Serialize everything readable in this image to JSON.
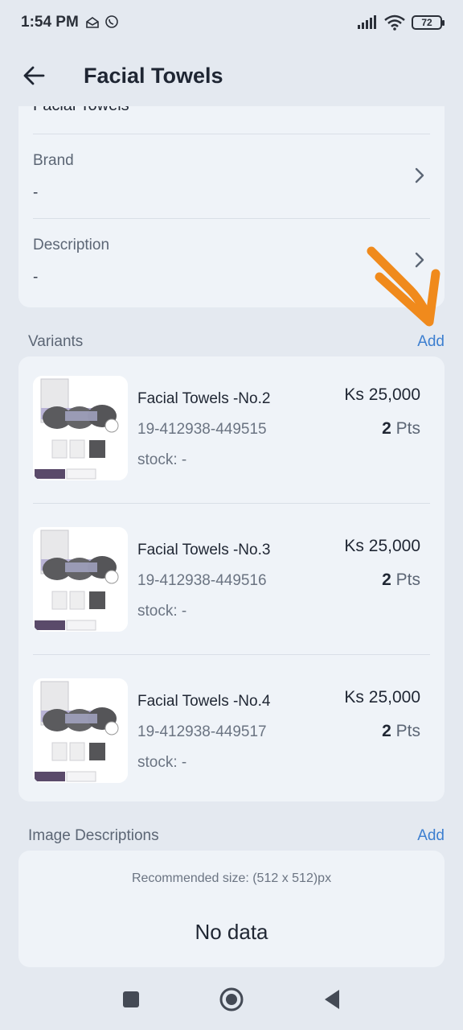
{
  "status_bar": {
    "time": "1:54 PM",
    "battery": "72"
  },
  "header": {
    "title": "Facial Towels"
  },
  "info_card": {
    "clipped_name": "Facial Towels",
    "rows": [
      {
        "label": "Brand",
        "value": "-"
      },
      {
        "label": "Description",
        "value": "-"
      }
    ]
  },
  "variants": {
    "title": "Variants",
    "add_label": "Add",
    "items": [
      {
        "name": "Facial Towels -No.2",
        "sku": "19-412938-449515",
        "stock": "stock: -",
        "price": "Ks 25,000",
        "pts_value": "2",
        "pts_unit": "Pts"
      },
      {
        "name": "Facial Towels -No.3",
        "sku": "19-412938-449516",
        "stock": "stock: -",
        "price": "Ks 25,000",
        "pts_value": "2",
        "pts_unit": "Pts"
      },
      {
        "name": "Facial Towels -No.4",
        "sku": "19-412938-449517",
        "stock": "stock: -",
        "price": "Ks 25,000",
        "pts_value": "2",
        "pts_unit": "Pts"
      }
    ]
  },
  "image_descriptions": {
    "title": "Image Descriptions",
    "add_label": "Add",
    "recommended": "Recommended size: (512 x 512)px",
    "empty": "No data"
  },
  "colors": {
    "accent": "#3d7fd0",
    "annotation": "#f08a1c",
    "background": "#e4e9f0",
    "card": "#eff3f8"
  },
  "icons": [
    "back-arrow-icon",
    "chevron-right-icon",
    "square-nav-icon",
    "home-circle-icon",
    "triangle-back-icon",
    "wifi-icon",
    "signal-icon",
    "battery-icon"
  ]
}
